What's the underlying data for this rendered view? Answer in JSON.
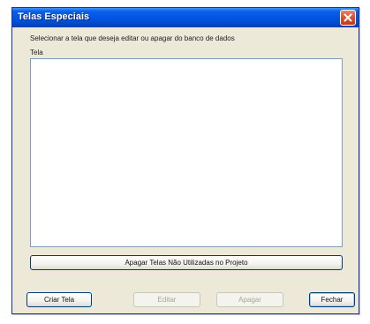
{
  "window": {
    "title": "Telas Especiais",
    "close_icon": "close-icon"
  },
  "main": {
    "instruction": "Selecionar a tela que deseja editar ou apagar do banco de dados",
    "list_label": "Tela",
    "list_items": []
  },
  "buttons": {
    "delete_unused": "Apagar Telas Não Utilizadas no Projeto",
    "create": "Criar Tela",
    "edit": "Editar",
    "delete": "Apagar",
    "close": "Fechar"
  },
  "colors": {
    "titlebar": "#0054e3",
    "window_bg": "#ece9d8",
    "close_button": "#d8512c",
    "list_border": "#7f9db9"
  }
}
